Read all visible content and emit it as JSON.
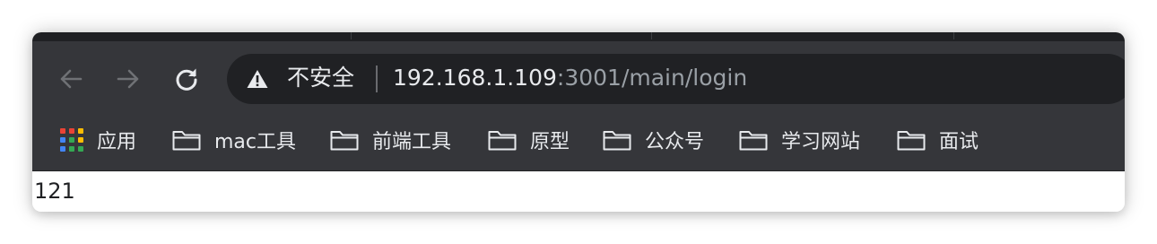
{
  "toolbar": {
    "back_icon": "arrow-left-icon",
    "forward_icon": "arrow-right-icon",
    "reload_icon": "reload-icon"
  },
  "omnibox": {
    "security_icon": "warning-triangle-icon",
    "security_label": "不安全",
    "url_host": "192.168.1.109",
    "url_path": ":3001/main/login"
  },
  "bookmarks": {
    "apps_label": "应用",
    "items": [
      {
        "label": "mac工具",
        "icon": "folder-icon"
      },
      {
        "label": "前端工具",
        "icon": "folder-icon"
      },
      {
        "label": "原型",
        "icon": "folder-icon"
      },
      {
        "label": "公众号",
        "icon": "folder-icon"
      },
      {
        "label": "学习网站",
        "icon": "folder-icon"
      },
      {
        "label": "面试",
        "icon": "folder-icon"
      }
    ]
  },
  "page": {
    "body_text": "121"
  },
  "colors": {
    "toolbar_bg": "#35363a",
    "omnibox_bg": "#202124",
    "text_primary": "#e8eaed",
    "text_dim": "#9aa0a6"
  }
}
